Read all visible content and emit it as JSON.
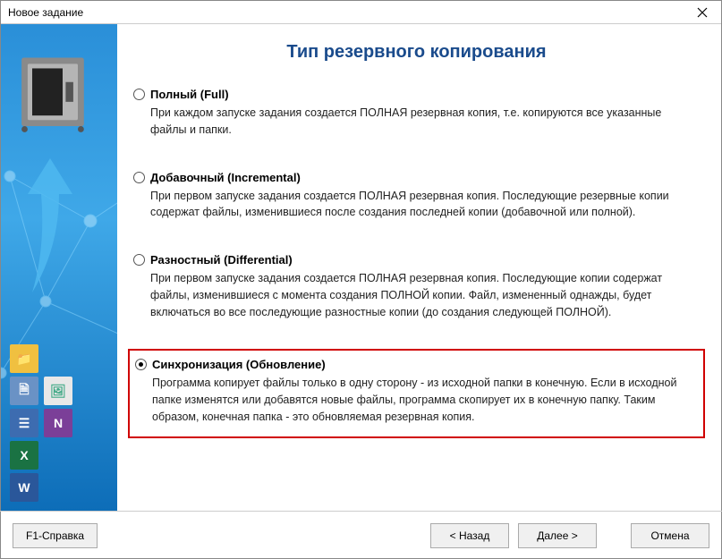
{
  "window": {
    "title": "Новое задание"
  },
  "page": {
    "heading": "Тип резервного копирования"
  },
  "options": {
    "full": {
      "label": "Полный (Full)",
      "desc": "При каждом запуске задания создается ПОЛНАЯ резервная копия, т.е. копируются все указанные файлы и папки."
    },
    "incremental": {
      "label": "Добавочный (Incremental)",
      "desc": "При первом запуске задания создается ПОЛНАЯ резервная копия. Последующие резервные копии содержат файлы, изменившиеся после создания последней копии (добавочной или полной)."
    },
    "differential": {
      "label": "Разностный (Differential)",
      "desc": "При первом запуске задания создается ПОЛНАЯ резервная копия. Последующие копии содержат файлы, изменившиеся с момента создания ПОЛНОЙ копии. Файл, измененный однажды, будет включаться во все последующие разностные копии (до создания следующей ПОЛНОЙ)."
    },
    "sync": {
      "label": "Синхронизация (Обновление)",
      "desc": "Программа копирует файлы только в одну сторону - из исходной папки в конечную. Если в исходной папке изменятся или добавятся новые файлы, программа скопирует их в конечную папку. Таким образом, конечная папка - это обновляемая резервная копия."
    }
  },
  "buttons": {
    "help": "F1-Справка",
    "back": "< Назад",
    "next": "Далее >",
    "cancel": "Отмена"
  },
  "icons": {
    "folder": "📁",
    "doc": "🗎",
    "pic": "🖼",
    "list": "☰",
    "one": "N",
    "xl": "X",
    "wd": "W"
  }
}
